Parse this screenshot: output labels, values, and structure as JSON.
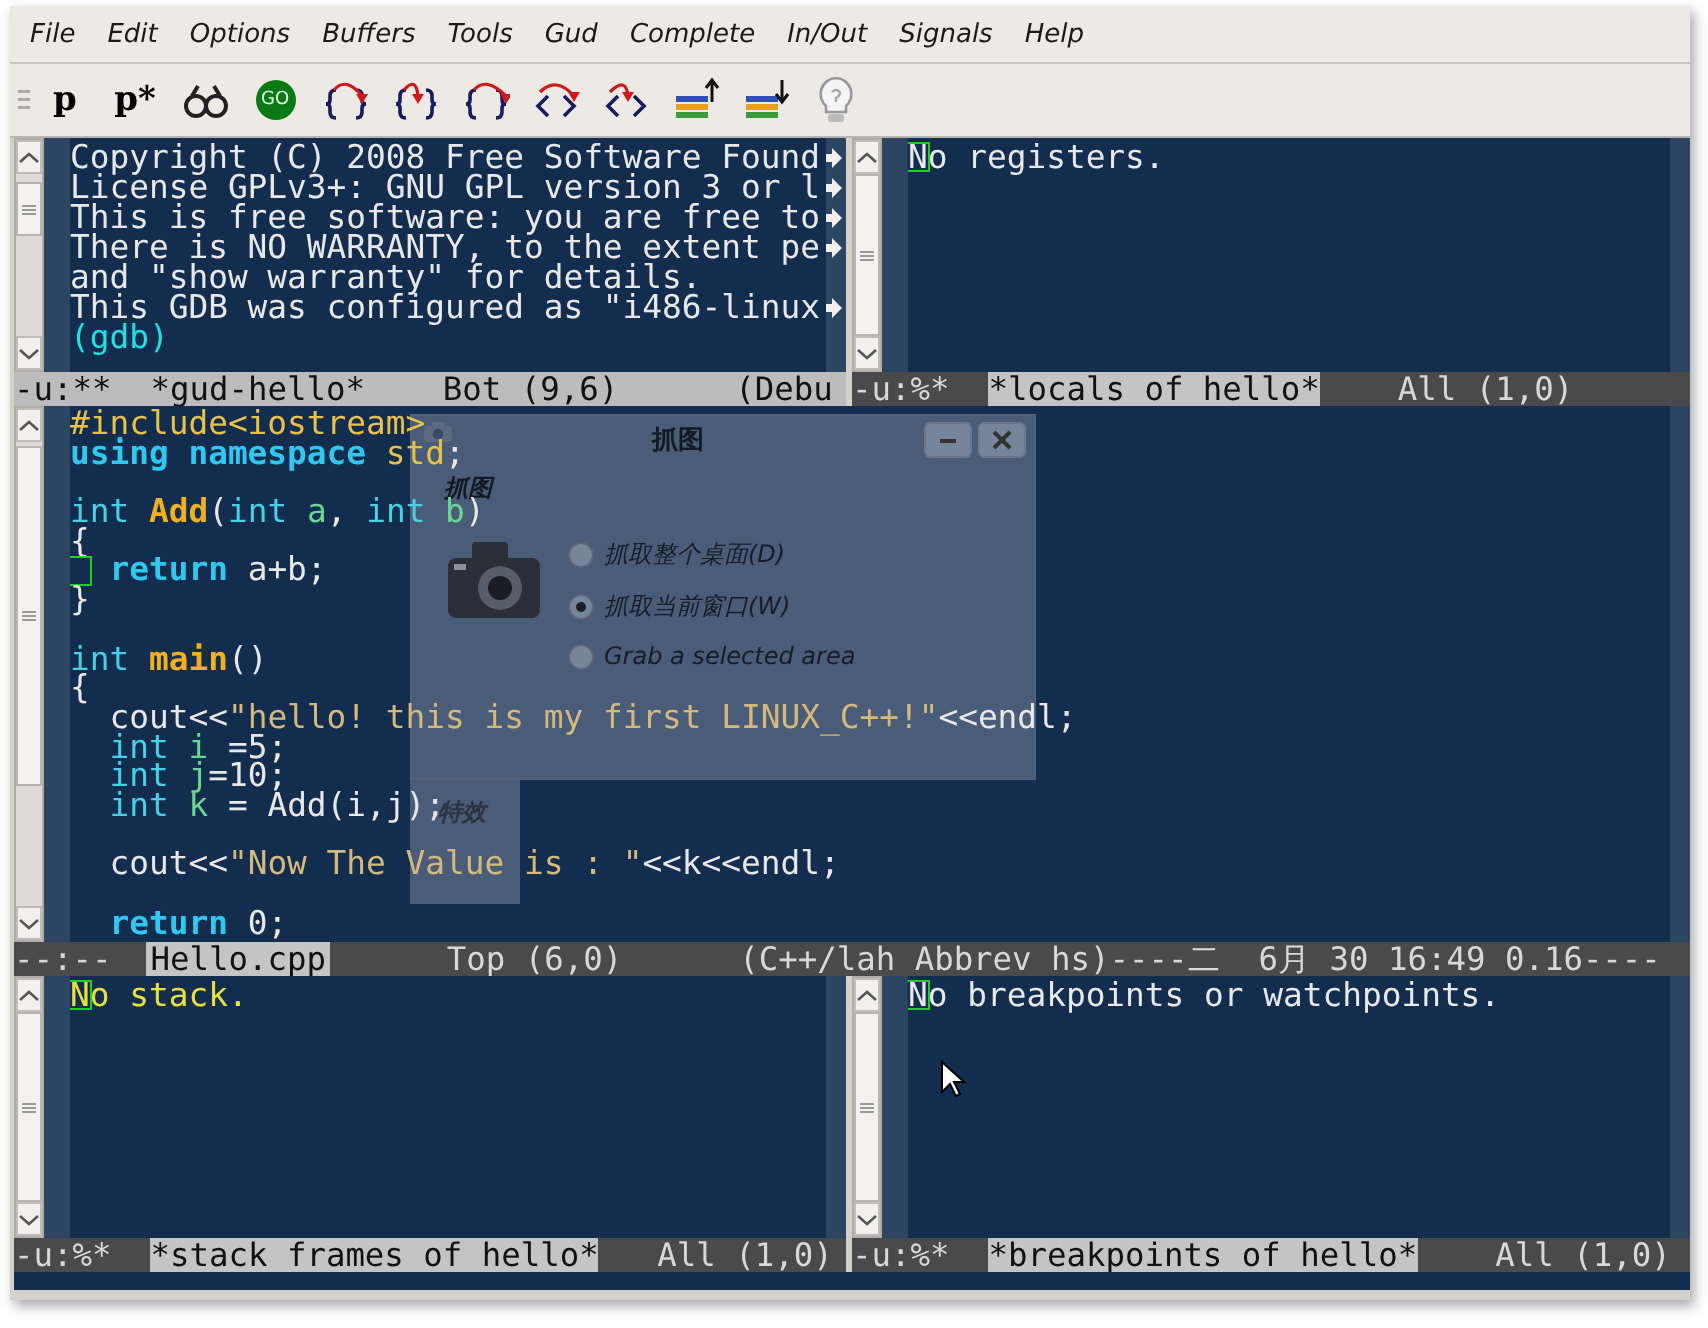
{
  "menu": [
    "File",
    "Edit",
    "Options",
    "Buffers",
    "Tools",
    "Gud",
    "Complete",
    "In/Out",
    "Signals",
    "Help"
  ],
  "toolbar": [
    {
      "kind": "text",
      "label": "p"
    },
    {
      "kind": "text",
      "label": "p*"
    },
    {
      "kind": "glasses"
    },
    {
      "kind": "go",
      "label": "GO"
    },
    {
      "kind": "brace-down"
    },
    {
      "kind": "brace-in"
    },
    {
      "kind": "brace-out"
    },
    {
      "kind": "angle-down"
    },
    {
      "kind": "angle-in"
    },
    {
      "kind": "stack-up"
    },
    {
      "kind": "stack-down"
    },
    {
      "kind": "bulb"
    }
  ],
  "top_left": {
    "lines": [
      {
        "continued": true,
        "segments": [
          {
            "kind": "plain",
            "text": "Copyright (C) 2008 Free Software Found"
          }
        ]
      },
      {
        "continued": true,
        "segments": [
          {
            "kind": "plain",
            "text": "License GPLv3+: GNU GPL version 3 or l"
          }
        ]
      },
      {
        "continued": true,
        "segments": [
          {
            "kind": "plain",
            "text": "This is free software: you are free to"
          }
        ]
      },
      {
        "continued": true,
        "segments": [
          {
            "kind": "plain",
            "text": "There is NO WARRANTY, to the extent pe"
          }
        ]
      },
      {
        "continued": false,
        "segments": [
          {
            "kind": "plain",
            "text": "and \"show warranty\" for details."
          }
        ]
      },
      {
        "continued": true,
        "segments": [
          {
            "kind": "plain",
            "text": "This GDB was configured as \"i486-linux"
          }
        ]
      },
      {
        "continued": false,
        "segments": [
          {
            "kind": "prompt",
            "text": "(gdb)"
          }
        ]
      }
    ],
    "mode_line": {
      "active": true,
      "prefix": "-u:**  ",
      "buffer": "*gud-hello*",
      "rest": "    Bot (9,6)      (Debu"
    }
  },
  "top_right": {
    "lines": [
      {
        "cursor": true,
        "segments": [
          {
            "kind": "plain",
            "text": "No registers."
          }
        ]
      }
    ],
    "mode_line": {
      "active": false,
      "prefix": "-u:%*  ",
      "buffer": "*locals of hello*",
      "rest": "    All (1,0)"
    }
  },
  "source": {
    "lines": [
      {
        "kind": "code",
        "segments": [
          {
            "kind": "preproc",
            "text": "#include<iostream>"
          }
        ]
      },
      {
        "kind": "code",
        "segments": [
          {
            "kind": "keyword",
            "text": "using namespace"
          },
          {
            "kind": "type-name",
            "text": " std"
          },
          {
            "kind": "plain",
            "text": ";"
          }
        ]
      },
      {
        "kind": "blank"
      },
      {
        "kind": "code",
        "segments": [
          {
            "kind": "type",
            "text": "int"
          },
          {
            "kind": "function",
            "text": " Add"
          },
          {
            "kind": "plain",
            "text": "("
          },
          {
            "kind": "type",
            "text": "int"
          },
          {
            "kind": "variable",
            "text": " a"
          },
          {
            "kind": "plain",
            "text": ", "
          },
          {
            "kind": "type",
            "text": "int"
          },
          {
            "kind": "variable",
            "text": " b"
          },
          {
            "kind": "plain",
            "text": ")"
          }
        ]
      },
      {
        "kind": "code",
        "segments": [
          {
            "kind": "plain",
            "text": "{"
          }
        ]
      },
      {
        "kind": "code",
        "cursor": true,
        "segments": [
          {
            "kind": "keyword",
            "text": "  return"
          },
          {
            "kind": "plain",
            "text": " a+b;"
          }
        ]
      },
      {
        "kind": "code",
        "segments": [
          {
            "kind": "plain",
            "text": "}"
          }
        ]
      },
      {
        "kind": "blank"
      },
      {
        "kind": "code",
        "segments": [
          {
            "kind": "type",
            "text": "int"
          },
          {
            "kind": "function",
            "text": " main"
          },
          {
            "kind": "plain",
            "text": "()"
          }
        ]
      },
      {
        "kind": "code",
        "segments": [
          {
            "kind": "plain",
            "text": "{"
          }
        ]
      },
      {
        "kind": "code",
        "segments": [
          {
            "kind": "plain",
            "text": "  cout<<"
          },
          {
            "kind": "string",
            "text": "\"hello! this is my first LINUX_C++!\""
          },
          {
            "kind": "plain",
            "text": "<<endl;"
          }
        ]
      },
      {
        "kind": "code",
        "segments": [
          {
            "kind": "type",
            "text": "  int"
          },
          {
            "kind": "variable",
            "text": " i"
          },
          {
            "kind": "plain",
            "text": " =5;"
          }
        ]
      },
      {
        "kind": "code",
        "segments": [
          {
            "kind": "type",
            "text": "  int"
          },
          {
            "kind": "variable",
            "text": " j"
          },
          {
            "kind": "plain",
            "text": "=10;"
          }
        ]
      },
      {
        "kind": "code",
        "segments": [
          {
            "kind": "type",
            "text": "  int"
          },
          {
            "kind": "variable",
            "text": " k"
          },
          {
            "kind": "plain",
            "text": " = Add(i,j);"
          }
        ]
      },
      {
        "kind": "blank"
      },
      {
        "kind": "code",
        "segments": [
          {
            "kind": "plain",
            "text": "  cout<<"
          },
          {
            "kind": "string",
            "text": "\"Now The Value is : \""
          },
          {
            "kind": "plain",
            "text": "<<k<<endl;"
          }
        ]
      },
      {
        "kind": "blank"
      },
      {
        "kind": "code",
        "segments": [
          {
            "kind": "keyword",
            "text": "  return"
          },
          {
            "kind": "plain",
            "text": " 0;"
          }
        ]
      }
    ],
    "mode_line": {
      "active": false,
      "prefix": "--:--  ",
      "buffer": "Hello.cpp",
      "rest": "      Top (6,0)      (C++/lah Abbrev hs)----二  6月 30 16:49 0.16----"
    }
  },
  "bottom_left": {
    "lines": [
      {
        "cursor": true,
        "segments": [
          {
            "kind": "notice",
            "text": "No stack."
          }
        ]
      }
    ],
    "mode_line": {
      "active": false,
      "prefix": "-u:%*  ",
      "buffer": "*stack frames of hello*",
      "rest": "   All (1,0)"
    }
  },
  "bottom_right": {
    "lines": [
      {
        "cursor": true,
        "segments": [
          {
            "kind": "plain",
            "text": "No breakpoints or watchpoints."
          }
        ]
      }
    ],
    "mode_line": {
      "active": false,
      "prefix": "-u:%*  ",
      "buffer": "*breakpoints of hello*",
      "rest": "    All (1,0)"
    }
  },
  "dialog": {
    "title": "抓图",
    "heading": "抓图",
    "options": [
      {
        "label": "抓取整个桌面(D)",
        "selected": false
      },
      {
        "label": "抓取当前窗口(W)",
        "selected": true
      },
      {
        "label": "Grab a selected area",
        "selected": false
      }
    ],
    "section": "特效"
  }
}
